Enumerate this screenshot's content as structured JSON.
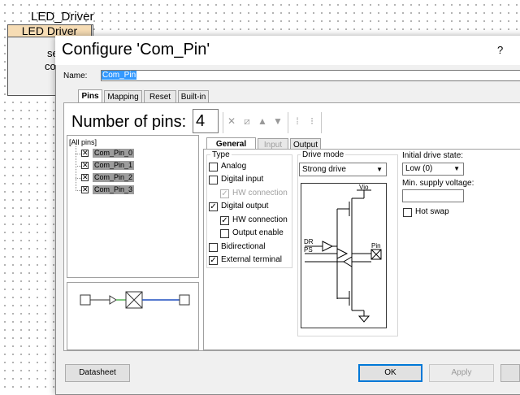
{
  "schematic": {
    "component_name": "LED_Driver",
    "component_header": "LED Driver",
    "partial_line1": "se",
    "partial_line2": "co"
  },
  "dialog": {
    "title": "Configure 'Com_Pin'",
    "help_label": "?",
    "name_label": "Name:",
    "name_value": "Com_Pin",
    "tabs": [
      "Pins",
      "Mapping",
      "Reset",
      "Built-in"
    ],
    "active_tab": "Pins",
    "number_of_pins_label": "Number of pins:",
    "number_of_pins_value": "4",
    "toolbar_icons": [
      "delete-icon",
      "auto-assign-icon",
      "move-up-icon",
      "move-down-icon",
      "group-icon",
      "ungroup-icon"
    ],
    "pin_tree": {
      "root": "[All pins]",
      "pins": [
        "Com_Pin_0",
        "Com_Pin_1",
        "Com_Pin_2",
        "Com_Pin_3"
      ]
    },
    "sub_tabs": [
      "General",
      "Input",
      "Output"
    ],
    "active_sub_tab": "General",
    "type_group": {
      "legend": "Type",
      "options": [
        {
          "label": "Analog",
          "checked": false,
          "enabled": true
        },
        {
          "label": "Digital input",
          "checked": false,
          "enabled": true
        },
        {
          "label": "HW connection",
          "checked": true,
          "enabled": false
        },
        {
          "label": "Digital output",
          "checked": true,
          "enabled": true
        },
        {
          "label": "HW connection",
          "checked": true,
          "enabled": true
        },
        {
          "label": "Output enable",
          "checked": false,
          "enabled": true
        },
        {
          "label": "Bidirectional",
          "checked": false,
          "enabled": true
        },
        {
          "label": "External terminal",
          "checked": true,
          "enabled": true
        }
      ]
    },
    "drive_mode": {
      "legend": "Drive mode",
      "selected": "Strong drive",
      "diagram_labels": {
        "vio": "Vio",
        "dr": "DR",
        "ps": "PS",
        "pin": "Pin"
      }
    },
    "initial_drive_state": {
      "label": "Initial drive state:",
      "selected": "Low (0)"
    },
    "min_supply_voltage": {
      "label": "Min. supply voltage:",
      "value": ""
    },
    "hot_swap": {
      "label": "Hot swap",
      "checked": false
    },
    "buttons": {
      "datasheet": "Datasheet",
      "ok": "OK",
      "apply": "Apply"
    }
  }
}
